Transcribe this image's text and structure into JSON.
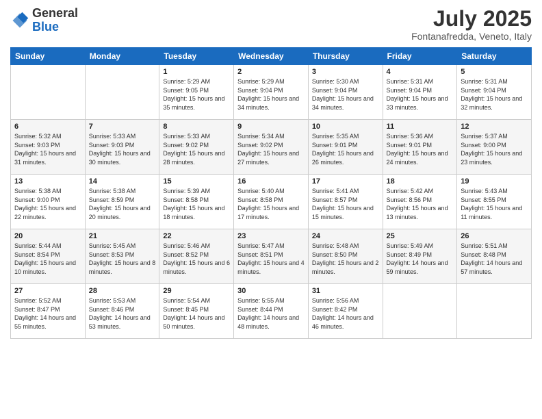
{
  "logo": {
    "general": "General",
    "blue": "Blue"
  },
  "header": {
    "month": "July 2025",
    "location": "Fontanafredda, Veneto, Italy"
  },
  "weekdays": [
    "Sunday",
    "Monday",
    "Tuesday",
    "Wednesday",
    "Thursday",
    "Friday",
    "Saturday"
  ],
  "weeks": [
    [
      {
        "day": "",
        "info": ""
      },
      {
        "day": "",
        "info": ""
      },
      {
        "day": "1",
        "info": "Sunrise: 5:29 AM\nSunset: 9:05 PM\nDaylight: 15 hours and 35 minutes."
      },
      {
        "day": "2",
        "info": "Sunrise: 5:29 AM\nSunset: 9:04 PM\nDaylight: 15 hours and 34 minutes."
      },
      {
        "day": "3",
        "info": "Sunrise: 5:30 AM\nSunset: 9:04 PM\nDaylight: 15 hours and 34 minutes."
      },
      {
        "day": "4",
        "info": "Sunrise: 5:31 AM\nSunset: 9:04 PM\nDaylight: 15 hours and 33 minutes."
      },
      {
        "day": "5",
        "info": "Sunrise: 5:31 AM\nSunset: 9:04 PM\nDaylight: 15 hours and 32 minutes."
      }
    ],
    [
      {
        "day": "6",
        "info": "Sunrise: 5:32 AM\nSunset: 9:03 PM\nDaylight: 15 hours and 31 minutes."
      },
      {
        "day": "7",
        "info": "Sunrise: 5:33 AM\nSunset: 9:03 PM\nDaylight: 15 hours and 30 minutes."
      },
      {
        "day": "8",
        "info": "Sunrise: 5:33 AM\nSunset: 9:02 PM\nDaylight: 15 hours and 28 minutes."
      },
      {
        "day": "9",
        "info": "Sunrise: 5:34 AM\nSunset: 9:02 PM\nDaylight: 15 hours and 27 minutes."
      },
      {
        "day": "10",
        "info": "Sunrise: 5:35 AM\nSunset: 9:01 PM\nDaylight: 15 hours and 26 minutes."
      },
      {
        "day": "11",
        "info": "Sunrise: 5:36 AM\nSunset: 9:01 PM\nDaylight: 15 hours and 24 minutes."
      },
      {
        "day": "12",
        "info": "Sunrise: 5:37 AM\nSunset: 9:00 PM\nDaylight: 15 hours and 23 minutes."
      }
    ],
    [
      {
        "day": "13",
        "info": "Sunrise: 5:38 AM\nSunset: 9:00 PM\nDaylight: 15 hours and 22 minutes."
      },
      {
        "day": "14",
        "info": "Sunrise: 5:38 AM\nSunset: 8:59 PM\nDaylight: 15 hours and 20 minutes."
      },
      {
        "day": "15",
        "info": "Sunrise: 5:39 AM\nSunset: 8:58 PM\nDaylight: 15 hours and 18 minutes."
      },
      {
        "day": "16",
        "info": "Sunrise: 5:40 AM\nSunset: 8:58 PM\nDaylight: 15 hours and 17 minutes."
      },
      {
        "day": "17",
        "info": "Sunrise: 5:41 AM\nSunset: 8:57 PM\nDaylight: 15 hours and 15 minutes."
      },
      {
        "day": "18",
        "info": "Sunrise: 5:42 AM\nSunset: 8:56 PM\nDaylight: 15 hours and 13 minutes."
      },
      {
        "day": "19",
        "info": "Sunrise: 5:43 AM\nSunset: 8:55 PM\nDaylight: 15 hours and 11 minutes."
      }
    ],
    [
      {
        "day": "20",
        "info": "Sunrise: 5:44 AM\nSunset: 8:54 PM\nDaylight: 15 hours and 10 minutes."
      },
      {
        "day": "21",
        "info": "Sunrise: 5:45 AM\nSunset: 8:53 PM\nDaylight: 15 hours and 8 minutes."
      },
      {
        "day": "22",
        "info": "Sunrise: 5:46 AM\nSunset: 8:52 PM\nDaylight: 15 hours and 6 minutes."
      },
      {
        "day": "23",
        "info": "Sunrise: 5:47 AM\nSunset: 8:51 PM\nDaylight: 15 hours and 4 minutes."
      },
      {
        "day": "24",
        "info": "Sunrise: 5:48 AM\nSunset: 8:50 PM\nDaylight: 15 hours and 2 minutes."
      },
      {
        "day": "25",
        "info": "Sunrise: 5:49 AM\nSunset: 8:49 PM\nDaylight: 14 hours and 59 minutes."
      },
      {
        "day": "26",
        "info": "Sunrise: 5:51 AM\nSunset: 8:48 PM\nDaylight: 14 hours and 57 minutes."
      }
    ],
    [
      {
        "day": "27",
        "info": "Sunrise: 5:52 AM\nSunset: 8:47 PM\nDaylight: 14 hours and 55 minutes."
      },
      {
        "day": "28",
        "info": "Sunrise: 5:53 AM\nSunset: 8:46 PM\nDaylight: 14 hours and 53 minutes."
      },
      {
        "day": "29",
        "info": "Sunrise: 5:54 AM\nSunset: 8:45 PM\nDaylight: 14 hours and 50 minutes."
      },
      {
        "day": "30",
        "info": "Sunrise: 5:55 AM\nSunset: 8:44 PM\nDaylight: 14 hours and 48 minutes."
      },
      {
        "day": "31",
        "info": "Sunrise: 5:56 AM\nSunset: 8:42 PM\nDaylight: 14 hours and 46 minutes."
      },
      {
        "day": "",
        "info": ""
      },
      {
        "day": "",
        "info": ""
      }
    ]
  ]
}
